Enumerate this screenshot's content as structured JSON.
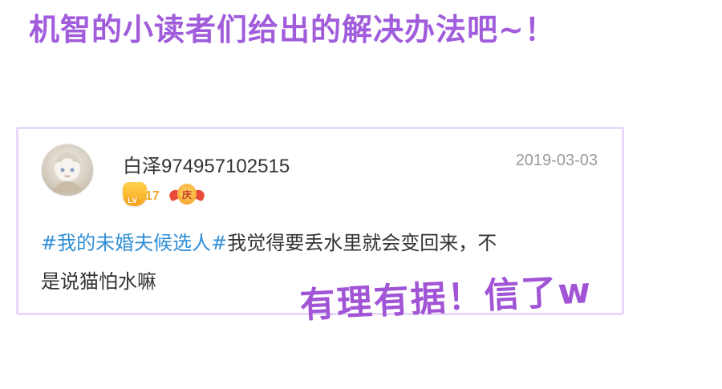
{
  "headline": "机智的小读者们给出的解决办法吧~！",
  "post": {
    "avatar_icon": "anime-avatar-icon",
    "username": "白泽974957102515",
    "date": "2019-03-03",
    "badges": {
      "level_prefix": "LV",
      "level_value": "17",
      "anniversary_char": "庆"
    },
    "hashtag": "#我的未婚夫候选人#",
    "content_line1": "我觉得要丢水里就会变回来，不",
    "content_line2": "是说猫怕水嘛"
  },
  "stamp": "有理有据！信了w",
  "colors": {
    "headline": "#a15cdc",
    "stamp": "#a154d6",
    "hashtag": "#2f8ed6",
    "card_border": "#e7d9f7"
  }
}
